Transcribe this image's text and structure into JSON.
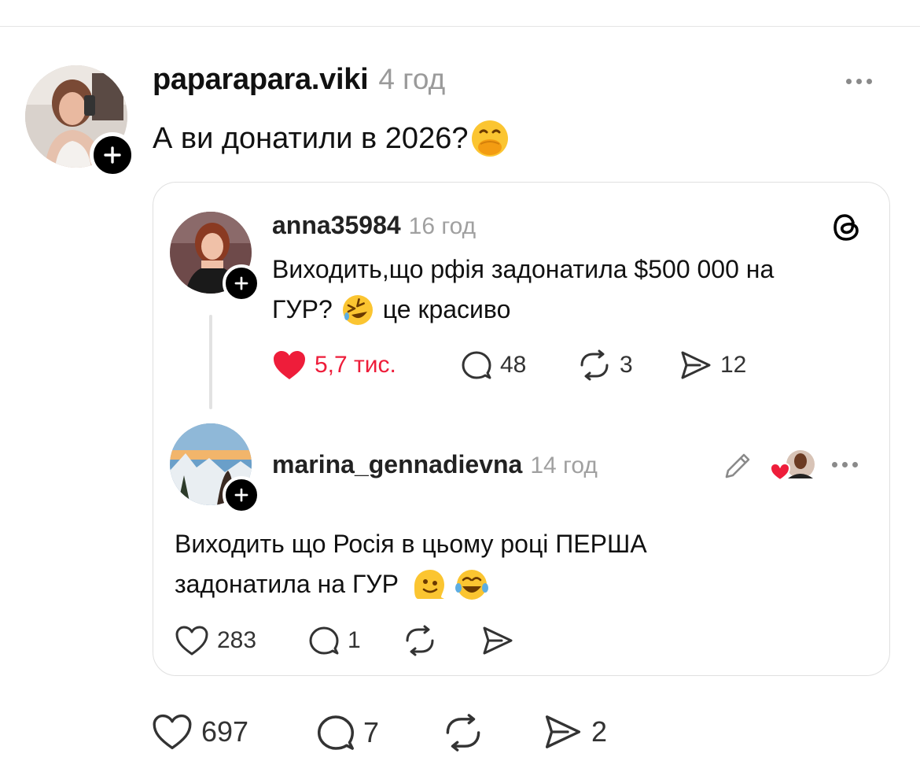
{
  "post": {
    "username": "paparapara.viki",
    "time": "4 год",
    "text": "А ви донатили в 2026?",
    "stats": {
      "likes": "697",
      "replies": "7",
      "shares": "2"
    }
  },
  "quote": {
    "parent": {
      "username": "anna35984",
      "time": "16 год",
      "text_line1": "Виходить,що рфія задонатила $500 000 на",
      "text_line2_a": "ГУР?",
      "text_line2_b": "це красиво",
      "stats": {
        "likes": "5,7 тис.",
        "replies": "48",
        "reposts": "3",
        "shares": "12"
      }
    },
    "reply": {
      "username": "marina_gennadievna",
      "time": "14 год",
      "text_line1": "Виходить що Росія в цьому році  ПЕРША",
      "text_line2": "задонатила  на ГУР",
      "stats": {
        "likes": "283",
        "replies": "1"
      }
    }
  },
  "colors": {
    "like_red": "#ee1d3a",
    "muted": "#9a9a9a",
    "border": "#e0e0e0"
  },
  "icons": [
    "heart-icon",
    "comment-icon",
    "repost-icon",
    "share-icon",
    "more-icon",
    "threads-logo-icon",
    "pencil-icon",
    "plus-icon"
  ]
}
